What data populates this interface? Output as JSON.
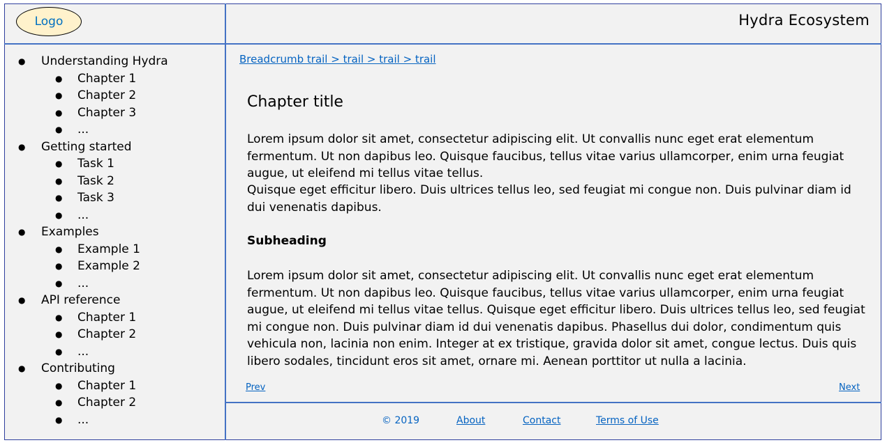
{
  "header": {
    "logo": "Logo",
    "site_title": "Hydra Ecosystem"
  },
  "sidebar": {
    "groups": [
      {
        "label": "Understanding Hydra",
        "items": [
          "Chapter 1",
          "Chapter 2",
          "Chapter 3",
          "..."
        ]
      },
      {
        "label": "Getting started",
        "items": [
          "Task 1",
          "Task 2",
          "Task 3",
          "..."
        ]
      },
      {
        "label": "Examples",
        "items": [
          "Example 1",
          "Example 2",
          "..."
        ]
      },
      {
        "label": "API reference",
        "items": [
          "Chapter 1",
          "Chapter 2",
          "..."
        ]
      },
      {
        "label": "Contributing",
        "items": [
          "Chapter 1",
          "Chapter 2",
          "..."
        ]
      }
    ]
  },
  "main": {
    "breadcrumb": "Breadcrumb trail > trail > trail > trail",
    "chapter_title": "Chapter title",
    "paragraph1": "Lorem ipsum dolor sit amet, consectetur adipiscing elit. Ut convallis nunc eget erat elementum fermentum. Ut non dapibus leo. Quisque faucibus, tellus vitae varius ullamcorper, enim urna feugiat augue, ut eleifend mi tellus vitae tellus.",
    "paragraph2": "Quisque eget efficitur libero. Duis ultrices tellus leo, sed feugiat mi congue non. Duis pulvinar diam id dui venenatis dapibus.",
    "subheading": "Subheading",
    "paragraph3": "Lorem ipsum dolor sit amet, consectetur adipiscing elit. Ut convallis nunc eget erat elementum fermentum. Ut non dapibus leo. Quisque faucibus, tellus vitae varius ullamcorper, enim urna feugiat augue, ut eleifend mi tellus vitae tellus. Quisque eget efficitur libero. Duis ultrices tellus leo, sed feugiat mi congue non. Duis pulvinar diam id dui venenatis dapibus. Phasellus dui dolor, condimentum quis vehicula non, lacinia non enim. Integer at ex tristique, gravida dolor sit amet, congue lectus. Duis quis libero sodales, tincidunt eros sit amet, ornare mi. Aenean porttitor ut nulla a lacinia.",
    "prev_label": "Prev",
    "next_label": "Next"
  },
  "footer": {
    "copyright": "© 2019",
    "about": "About",
    "contact": "Contact",
    "terms": "Terms of Use"
  },
  "colors": {
    "border": "#4472c4",
    "link": "#0563c1",
    "logo_fill": "#fff2cc",
    "background": "#f2f2f2"
  }
}
